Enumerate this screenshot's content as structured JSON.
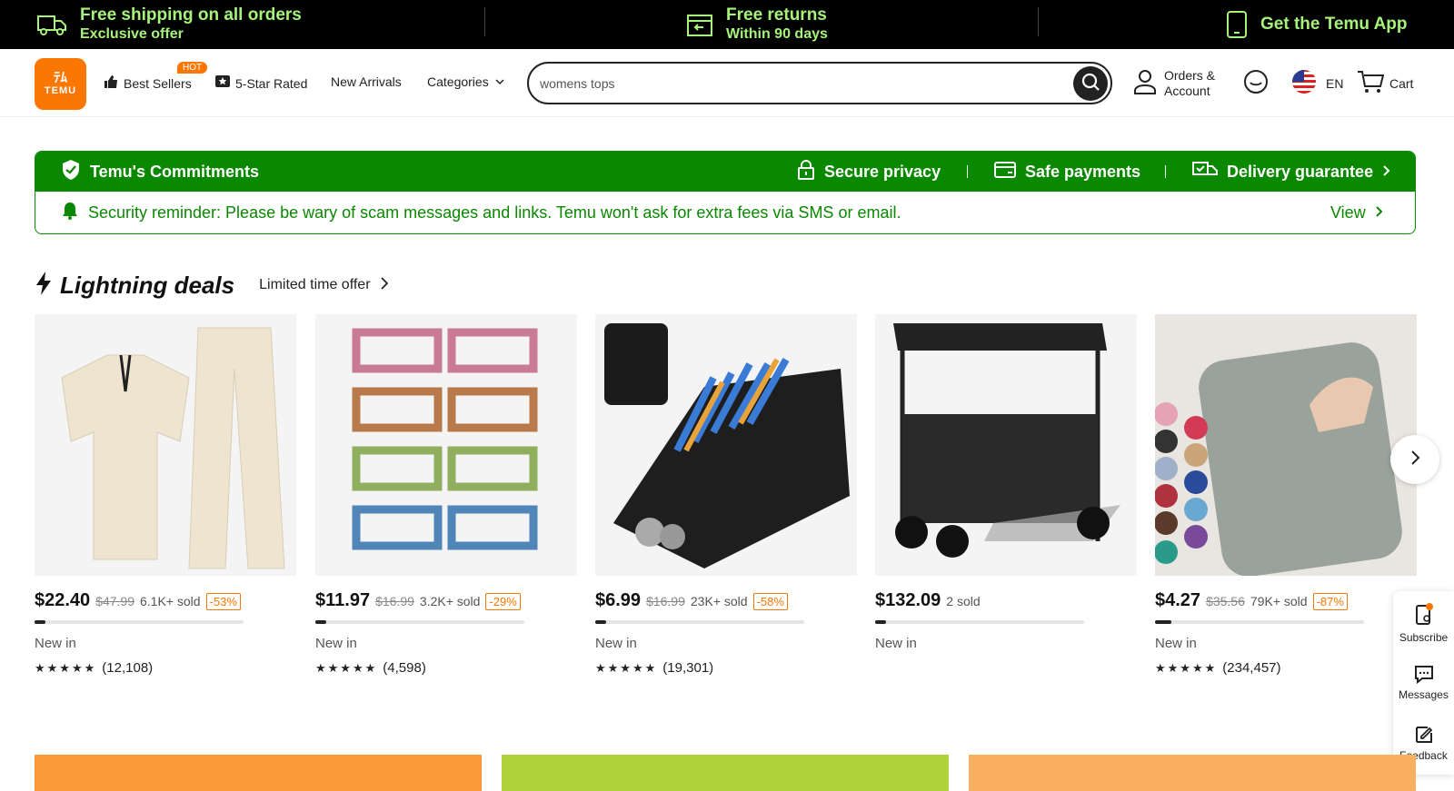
{
  "promo": {
    "shipping_title": "Free shipping on all orders",
    "shipping_sub": "Exclusive offer",
    "returns_title": "Free returns",
    "returns_sub": "Within 90 days",
    "app": "Get the Temu App"
  },
  "header": {
    "logo_line1": "ﾃﾑ",
    "logo_line2": "TEMU",
    "hot_badge": "HOT",
    "nav": [
      "Best Sellers",
      "5-Star Rated",
      "New Arrivals",
      "Categories"
    ],
    "search_value": "womens tops",
    "orders_line1": "Orders &",
    "orders_line2": "Account",
    "language": "EN",
    "cart": "Cart"
  },
  "commitments": {
    "title": "Temu's Commitments",
    "items": [
      "Secure privacy",
      "Safe payments",
      "Delivery guarantee"
    ],
    "reminder": "Security reminder: Please be wary of scam messages and links. Temu won't ask for extra fees via SMS or email.",
    "view": "View"
  },
  "deals": {
    "title": "Lightning deals",
    "subtitle": "Limited time offer",
    "products": [
      {
        "price": "$22.40",
        "old": "$47.99",
        "sold": "6.1K+ sold",
        "discount": "-53%",
        "progress": 0.05,
        "newin": "New in",
        "stars": "★★★★★",
        "reviews": "(12,108)"
      },
      {
        "price": "$11.97",
        "old": "$16.99",
        "sold": "3.2K+ sold",
        "discount": "-29%",
        "progress": 0.05,
        "newin": "New in",
        "stars": "★★★★★",
        "reviews": "(4,598)"
      },
      {
        "price": "$6.99",
        "old": "$16.99",
        "sold": "23K+ sold",
        "discount": "-58%",
        "progress": 0.05,
        "newin": "New in",
        "stars": "★★★★★",
        "reviews": "(19,301)"
      },
      {
        "price": "$132.09",
        "old": "",
        "sold": "2 sold",
        "discount": "",
        "progress": 0.05,
        "newin": "New in",
        "stars": "",
        "reviews": ""
      },
      {
        "price": "$4.27",
        "old": "$35.56",
        "sold": "79K+ sold",
        "discount": "-87%",
        "progress": 0.08,
        "newin": "New in",
        "stars": "★★★★★",
        "reviews": "(234,457)"
      }
    ]
  },
  "side": {
    "subscribe": "Subscribe",
    "messages": "Messages",
    "feedback": "Feedback"
  },
  "colors": {
    "brand_orange": "#fb7701",
    "promo_green": "#a6f27a",
    "commit_green": "#0a8800"
  }
}
